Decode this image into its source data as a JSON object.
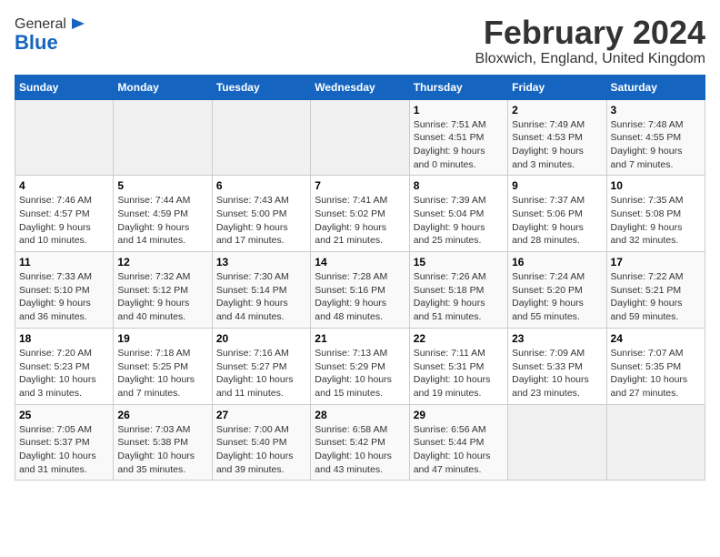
{
  "header": {
    "logo_general": "General",
    "logo_blue": "Blue",
    "title": "February 2024",
    "subtitle": "Bloxwich, England, United Kingdom"
  },
  "calendar": {
    "days_of_week": [
      "Sunday",
      "Monday",
      "Tuesday",
      "Wednesday",
      "Thursday",
      "Friday",
      "Saturday"
    ],
    "weeks": [
      [
        {
          "day": "",
          "info": ""
        },
        {
          "day": "",
          "info": ""
        },
        {
          "day": "",
          "info": ""
        },
        {
          "day": "",
          "info": ""
        },
        {
          "day": "1",
          "info": "Sunrise: 7:51 AM\nSunset: 4:51 PM\nDaylight: 9 hours\nand 0 minutes."
        },
        {
          "day": "2",
          "info": "Sunrise: 7:49 AM\nSunset: 4:53 PM\nDaylight: 9 hours\nand 3 minutes."
        },
        {
          "day": "3",
          "info": "Sunrise: 7:48 AM\nSunset: 4:55 PM\nDaylight: 9 hours\nand 7 minutes."
        }
      ],
      [
        {
          "day": "4",
          "info": "Sunrise: 7:46 AM\nSunset: 4:57 PM\nDaylight: 9 hours\nand 10 minutes."
        },
        {
          "day": "5",
          "info": "Sunrise: 7:44 AM\nSunset: 4:59 PM\nDaylight: 9 hours\nand 14 minutes."
        },
        {
          "day": "6",
          "info": "Sunrise: 7:43 AM\nSunset: 5:00 PM\nDaylight: 9 hours\nand 17 minutes."
        },
        {
          "day": "7",
          "info": "Sunrise: 7:41 AM\nSunset: 5:02 PM\nDaylight: 9 hours\nand 21 minutes."
        },
        {
          "day": "8",
          "info": "Sunrise: 7:39 AM\nSunset: 5:04 PM\nDaylight: 9 hours\nand 25 minutes."
        },
        {
          "day": "9",
          "info": "Sunrise: 7:37 AM\nSunset: 5:06 PM\nDaylight: 9 hours\nand 28 minutes."
        },
        {
          "day": "10",
          "info": "Sunrise: 7:35 AM\nSunset: 5:08 PM\nDaylight: 9 hours\nand 32 minutes."
        }
      ],
      [
        {
          "day": "11",
          "info": "Sunrise: 7:33 AM\nSunset: 5:10 PM\nDaylight: 9 hours\nand 36 minutes."
        },
        {
          "day": "12",
          "info": "Sunrise: 7:32 AM\nSunset: 5:12 PM\nDaylight: 9 hours\nand 40 minutes."
        },
        {
          "day": "13",
          "info": "Sunrise: 7:30 AM\nSunset: 5:14 PM\nDaylight: 9 hours\nand 44 minutes."
        },
        {
          "day": "14",
          "info": "Sunrise: 7:28 AM\nSunset: 5:16 PM\nDaylight: 9 hours\nand 48 minutes."
        },
        {
          "day": "15",
          "info": "Sunrise: 7:26 AM\nSunset: 5:18 PM\nDaylight: 9 hours\nand 51 minutes."
        },
        {
          "day": "16",
          "info": "Sunrise: 7:24 AM\nSunset: 5:20 PM\nDaylight: 9 hours\nand 55 minutes."
        },
        {
          "day": "17",
          "info": "Sunrise: 7:22 AM\nSunset: 5:21 PM\nDaylight: 9 hours\nand 59 minutes."
        }
      ],
      [
        {
          "day": "18",
          "info": "Sunrise: 7:20 AM\nSunset: 5:23 PM\nDaylight: 10 hours\nand 3 minutes."
        },
        {
          "day": "19",
          "info": "Sunrise: 7:18 AM\nSunset: 5:25 PM\nDaylight: 10 hours\nand 7 minutes."
        },
        {
          "day": "20",
          "info": "Sunrise: 7:16 AM\nSunset: 5:27 PM\nDaylight: 10 hours\nand 11 minutes."
        },
        {
          "day": "21",
          "info": "Sunrise: 7:13 AM\nSunset: 5:29 PM\nDaylight: 10 hours\nand 15 minutes."
        },
        {
          "day": "22",
          "info": "Sunrise: 7:11 AM\nSunset: 5:31 PM\nDaylight: 10 hours\nand 19 minutes."
        },
        {
          "day": "23",
          "info": "Sunrise: 7:09 AM\nSunset: 5:33 PM\nDaylight: 10 hours\nand 23 minutes."
        },
        {
          "day": "24",
          "info": "Sunrise: 7:07 AM\nSunset: 5:35 PM\nDaylight: 10 hours\nand 27 minutes."
        }
      ],
      [
        {
          "day": "25",
          "info": "Sunrise: 7:05 AM\nSunset: 5:37 PM\nDaylight: 10 hours\nand 31 minutes."
        },
        {
          "day": "26",
          "info": "Sunrise: 7:03 AM\nSunset: 5:38 PM\nDaylight: 10 hours\nand 35 minutes."
        },
        {
          "day": "27",
          "info": "Sunrise: 7:00 AM\nSunset: 5:40 PM\nDaylight: 10 hours\nand 39 minutes."
        },
        {
          "day": "28",
          "info": "Sunrise: 6:58 AM\nSunset: 5:42 PM\nDaylight: 10 hours\nand 43 minutes."
        },
        {
          "day": "29",
          "info": "Sunrise: 6:56 AM\nSunset: 5:44 PM\nDaylight: 10 hours\nand 47 minutes."
        },
        {
          "day": "",
          "info": ""
        },
        {
          "day": "",
          "info": ""
        }
      ]
    ]
  }
}
